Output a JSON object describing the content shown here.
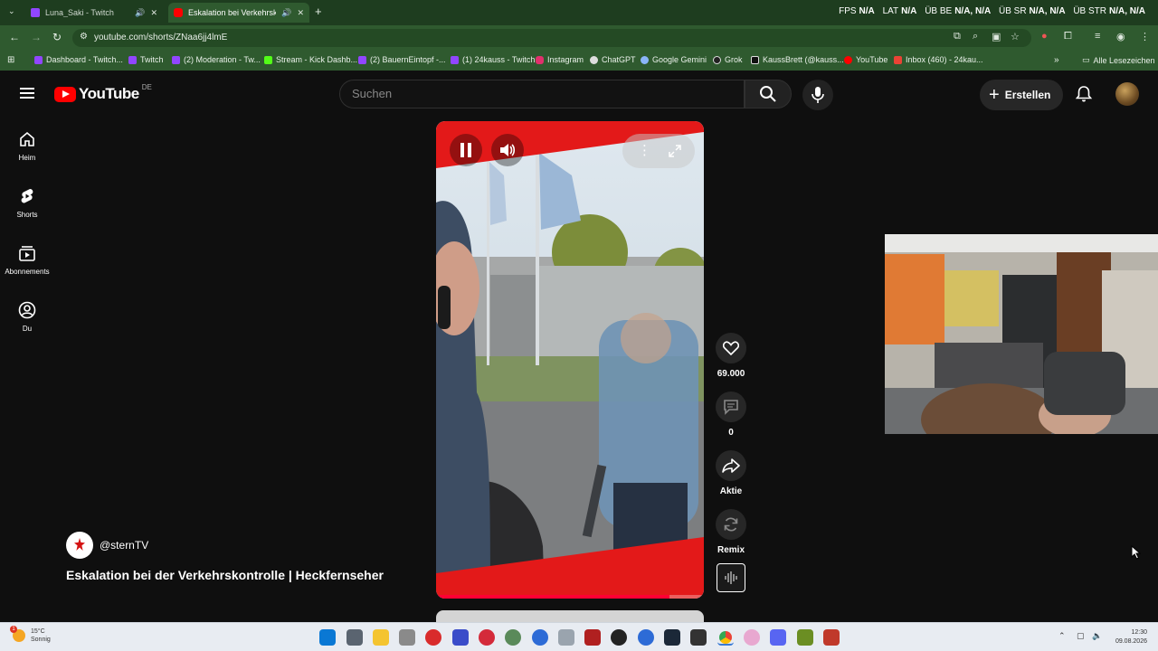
{
  "browser": {
    "tabs": [
      {
        "title": "Luna_Saki - Twitch",
        "active": false,
        "favicon_color": "#9146ff"
      },
      {
        "title": "Eskalation bei Verkehrskontrolle",
        "active": true,
        "favicon_color": "#ff0000"
      }
    ],
    "new_tab": "+",
    "url": "youtube.com/shorts/ZNaa6jj4lmE",
    "stats": {
      "fps_label": "FPS",
      "fps_value": "N/A",
      "lat_label": "LAT",
      "lat_value": "N/A",
      "ub_be_label": "ÜB BE",
      "ub_be_value": "N/A, N/A",
      "ub_sr_label": "ÜB SR",
      "ub_sr_value": "N/A, N/A",
      "ub_str_label": "ÜB STR",
      "ub_str_value": "N/A, N/A"
    },
    "bookmarks": [
      {
        "label": "Dashboard - Twitch...",
        "color": "#9146ff"
      },
      {
        "label": "Twitch",
        "color": "#9146ff"
      },
      {
        "label": "(2) Moderation - Tw...",
        "color": "#9146ff"
      },
      {
        "label": "Stream - Kick Dashb...",
        "color": "#53fc18"
      },
      {
        "label": "(2) BauernEintopf -...",
        "color": "#9146ff"
      },
      {
        "label": "(1) 24kauss - Twitch",
        "color": "#9146ff"
      },
      {
        "label": "Instagram",
        "color": "#e1306c"
      },
      {
        "label": "ChatGPT",
        "color": "#dddddd"
      },
      {
        "label": "Google Gemini",
        "color": "#8ab4f8"
      },
      {
        "label": "Grok",
        "color": "#222222"
      },
      {
        "label": "KaussBrett (@kauss...",
        "color": "#111111"
      },
      {
        "label": "YouTube",
        "color": "#ff0000"
      },
      {
        "label": "Inbox (460) - 24kau...",
        "color": "#ea4335"
      }
    ],
    "bookmarks_more": "»",
    "all_bookmarks": "Alle Lesezeichen"
  },
  "youtube": {
    "logo_text": "YouTube",
    "country_code": "DE",
    "search_placeholder": "Suchen",
    "create_label": "Erstellen",
    "guide": [
      {
        "label": "Heim",
        "icon": "home-icon"
      },
      {
        "label": "Shorts",
        "icon": "shorts-icon"
      },
      {
        "label": "Abonnements",
        "icon": "subscriptions-icon"
      },
      {
        "label": "Du",
        "icon": "account-icon"
      }
    ],
    "channel_handle": "@sternTV",
    "video_title": "Eskalation bei der Verkehrskontrolle | Heckfernseher",
    "actions": {
      "likes": "69.000",
      "comments": "0",
      "share_label": "Aktie",
      "remix_label": "Remix"
    },
    "progress_fraction": 0.87
  },
  "taskbar": {
    "temperature": "15°C",
    "weather": "Sonnig",
    "weather_badge": "1",
    "time": "12:30",
    "date": "09.08.2026"
  },
  "colors": {
    "youtube_red": "#ff0000",
    "browser_green": "#2f5a2f",
    "background": "#0f0f0f"
  }
}
